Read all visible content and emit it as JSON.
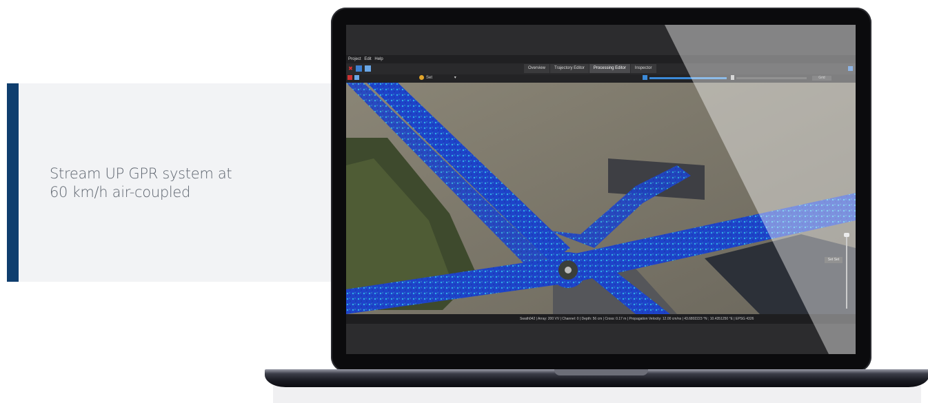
{
  "caption": {
    "line1": "Stream UP GPR system at",
    "line2": "60 km/h air-coupled"
  },
  "app": {
    "menu": [
      "Project",
      "Edit",
      "Help"
    ],
    "tabs": [
      "Overview",
      "Trajectory Editor",
      "Processing Editor",
      "Inspector"
    ],
    "active_tab": "Processing Editor",
    "layer_select": "Set",
    "scale_box": "Grid",
    "map_label": "Set Set",
    "status": "Swath042 | Array: 200 VV | Channel: 0 | Depth: 56 cm | Cross: 0.17 m | Propagation Velocity: 12.00 cm/ns | 43.6802223 °N ; 10.4351250 °E | EPSG 4326"
  },
  "colors": {
    "accent_bar": "#0f3e6e",
    "gpr_overlay": "#1f4fd6",
    "app_bg": "#2c2c2e"
  },
  "icons": [
    "close-icon",
    "open-folder-icon",
    "save-icon",
    "layer-icon",
    "export-icon",
    "gradient-icon"
  ]
}
